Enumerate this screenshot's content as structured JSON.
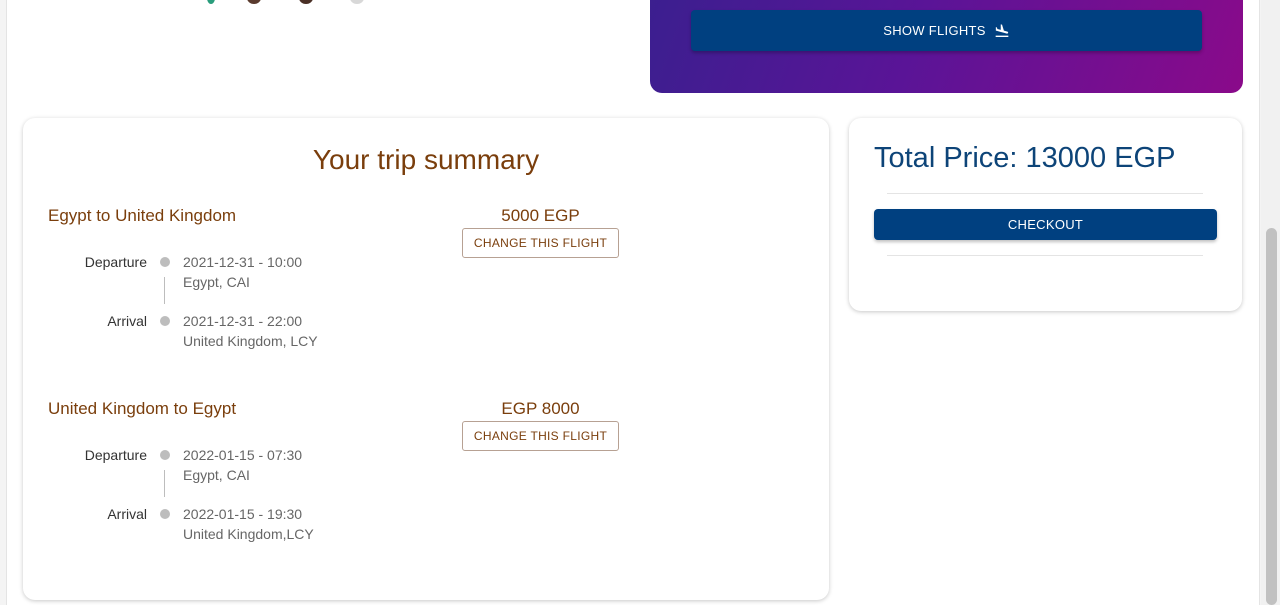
{
  "search": {
    "show_flights_label": "SHOW FLIGHTS",
    "show_flights_icon": "flight-landing-icon",
    "accent": "#004080"
  },
  "summary": {
    "title": "Your trip summary",
    "legs": [
      {
        "title": "Egypt to United Kingdom",
        "price": "5000 EGP",
        "change_label": "CHANGE THIS FLIGHT",
        "departure": {
          "label": "Departure",
          "time": "2021-12-31 - 10:00",
          "place": "Egypt, CAI"
        },
        "arrival": {
          "label": "Arrival",
          "time": "2021-12-31 - 22:00",
          "place": "United Kingdom, LCY"
        }
      },
      {
        "title": "United Kingdom to Egypt",
        "price": "EGP 8000",
        "change_label": "CHANGE THIS FLIGHT",
        "departure": {
          "label": "Departure",
          "time": "2022-01-15 - 07:30",
          "place": "Egypt, CAI"
        },
        "arrival": {
          "label": "Arrival",
          "time": "2022-01-15 - 19:30",
          "place": "United Kingdom,LCY"
        }
      }
    ]
  },
  "total": {
    "title": "Total Price: 13000 EGP",
    "checkout_label": "CHECKOUT"
  },
  "colors": {
    "brown_text": "#7a3e0c",
    "navy_text": "#0d4478",
    "button_blue": "#004080",
    "panel_gradient": [
      "#3b1f8f",
      "#8a0a8a"
    ]
  }
}
